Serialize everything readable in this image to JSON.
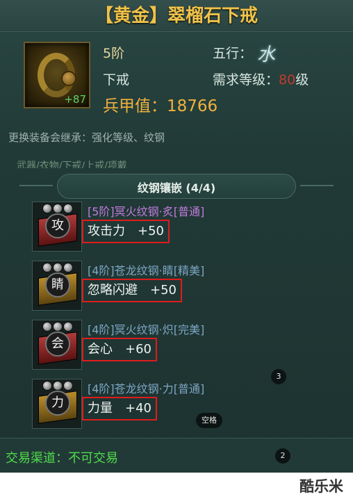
{
  "item": {
    "title": "【黄金】翠榴石下戒",
    "enhance_level": "+87",
    "tier": "5阶",
    "slot": "下戒",
    "element_label": "五行：",
    "element_icon": "water-glyph-icon",
    "required_level_label": "需求等级：",
    "required_level": "80",
    "required_level_suffix": "级",
    "power_label": "兵甲值：",
    "power_value": "18766",
    "inherit_note": "更换装备会继承：强化等级、纹钢",
    "partial_tabs": "武器/衣物/下戒/上戒/项戴"
  },
  "inlay": {
    "section_title": "纹钢镶嵌 (4/4)",
    "gems": [
      {
        "glyph": "攻",
        "name": "[5阶]冥火纹钢·炙[普通]",
        "stat": "攻击力　+50",
        "color": "purple",
        "base": "red"
      },
      {
        "glyph": "睛",
        "name": "[4阶]苍龙纹钢·睛[精美]",
        "stat": "忽略闪避　+50",
        "color": "blue",
        "base": "gold"
      },
      {
        "glyph": "会",
        "name": "[4阶]冥火纹钢·炽[完美]",
        "stat": "会心　+60",
        "color": "blue",
        "base": "red"
      },
      {
        "glyph": "力",
        "name": "[4阶]苍龙纹钢·力[普通]",
        "stat": "力量　+40",
        "color": "blue",
        "base": "gold"
      }
    ]
  },
  "footer": {
    "trade_channel": "交易渠道：不可交易"
  },
  "hints": {
    "badge_3": "3",
    "badge_2": "2",
    "space_key": "空格"
  },
  "watermark": "酷乐米",
  "colors": {
    "title_gold": "#f0c24a",
    "power_orange": "#f1b23e",
    "level_red": "#c43a2e",
    "trade_green": "#4fdc4a",
    "highlight_red": "#e01c1c"
  }
}
